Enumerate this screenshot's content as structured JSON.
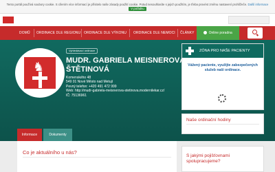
{
  "cookie": {
    "text": "Tento portál používá soubory cookie. S cílením více informací je přísitelo naše zásady použití cookie. Potud nesouhlasíte s jejich použitím, je třeba provést změnu nastavení prohlížeče.",
    "more_label": "Další informace",
    "ok_label": "V pořádku"
  },
  "nav": {
    "items": [
      "Domů",
      "Ordinace dle regionu",
      "Ordinace dle výkonu",
      "Ordinace dle nemoci",
      "Články"
    ],
    "cta_label": "Online poradna"
  },
  "profile": {
    "tag": "Vyhledávací ordinace",
    "name": "MUDr. Gabriela Meisnerová Štětinová",
    "address": "Komenského 48",
    "city": "549 01 Nové Město nad Metují",
    "phone": "Pevný telefon: +420 491 472 999",
    "web": "Web: http://mudr-gabriela-meisnerova-stetinova.modernilekar.cz/",
    "ic": "IČ: 75136961"
  },
  "tabs": {
    "info": "Informace",
    "documents": "Dokumenty"
  },
  "content": {
    "title": "Co je aktuálního u nás?"
  },
  "side": {
    "zone_title": "Zóna pro naše pacienty",
    "zone_text": "Vážený paciente, využijte zabezpečených služeb naší ordinace.",
    "hours_title": "Naše ordinační hodiny",
    "insurance_title": "S jakými pojišťovnami spolupracujeme?"
  },
  "colors": {
    "brand_red": "#c62b2b",
    "teal": "#0f5a51",
    "green_cta": "#4aa546"
  }
}
